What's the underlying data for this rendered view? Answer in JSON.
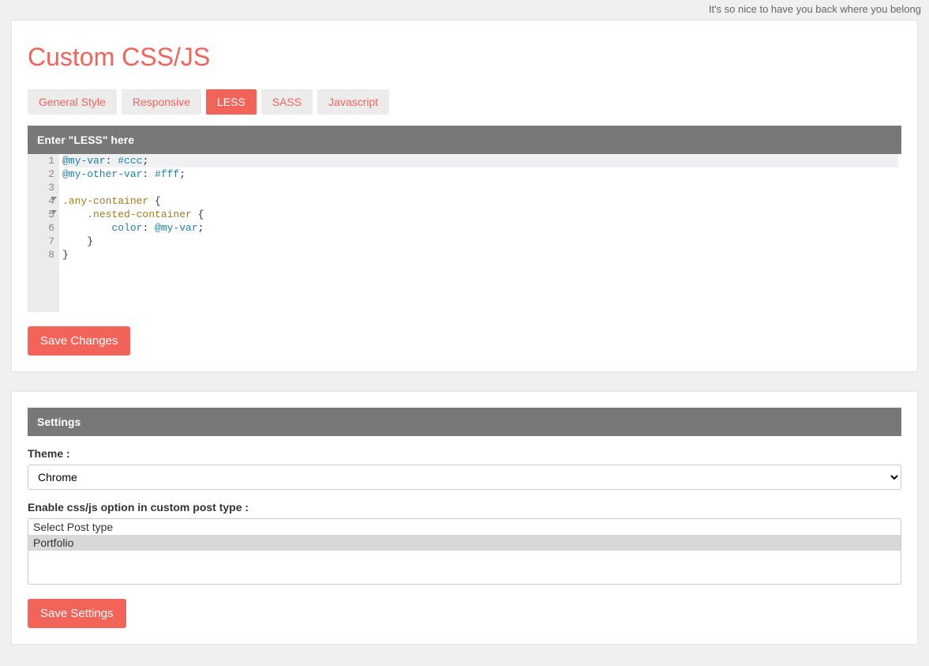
{
  "topbar": {
    "welcome": "It's so nice to have you back where you belong"
  },
  "page": {
    "title": "Custom CSS/JS"
  },
  "tabs": {
    "items": [
      {
        "label": "General Style",
        "active": false
      },
      {
        "label": "Responsive",
        "active": false
      },
      {
        "label": "LESS",
        "active": true
      },
      {
        "label": "SASS",
        "active": false
      },
      {
        "label": "Javascript",
        "active": false
      }
    ]
  },
  "editor": {
    "header": "Enter \"LESS\" here",
    "lines": [
      "@my-var: #ccc;",
      "@my-other-var: #fff;",
      "",
      ".any-container {",
      "    .nested-container {",
      "        color: @my-var;",
      "    }",
      "}"
    ]
  },
  "buttons": {
    "save_changes": "Save Changes",
    "save_settings": "Save Settings"
  },
  "settings": {
    "header": "Settings",
    "theme_label": "Theme :",
    "theme_value": "Chrome",
    "posttype_label": "Enable css/js option in custom post type :",
    "posttype_options": [
      {
        "label": "Select Post type",
        "selected": false
      },
      {
        "label": "Portfolio",
        "selected": true
      }
    ]
  }
}
